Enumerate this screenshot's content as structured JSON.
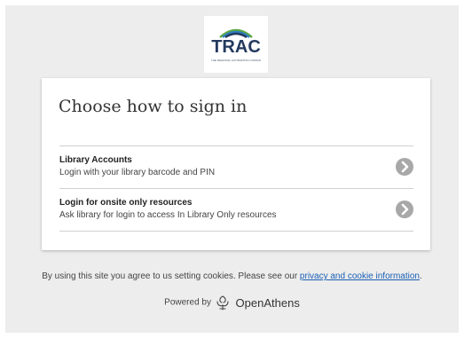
{
  "logo": {
    "text": "TRAC",
    "tagline": "THE REGIONAL AUTOMATION CONSORTIUM"
  },
  "card": {
    "title": "Choose how to sign in",
    "options": [
      {
        "title": "Library Accounts",
        "description": "Login with your library barcode and PIN",
        "icon": "chevron-right-icon"
      },
      {
        "title": "Login for onsite only resources",
        "description": "Ask library for login to access In Library Only resources",
        "icon": "chevron-right-icon"
      }
    ]
  },
  "footer": {
    "text_before": "By using this site you agree to us setting cookies. Please see our ",
    "link": "privacy and cookie information",
    "text_after": "."
  },
  "powered": {
    "label": "Powered by",
    "brand": "OpenAthens"
  },
  "colors": {
    "background": "#ededed",
    "link": "#1a5fb4",
    "logo_navy": "#233a5e",
    "logo_green": "#5aa645",
    "logo_blue": "#2f7fc1",
    "chevron_bg": "#a8a8a8"
  }
}
